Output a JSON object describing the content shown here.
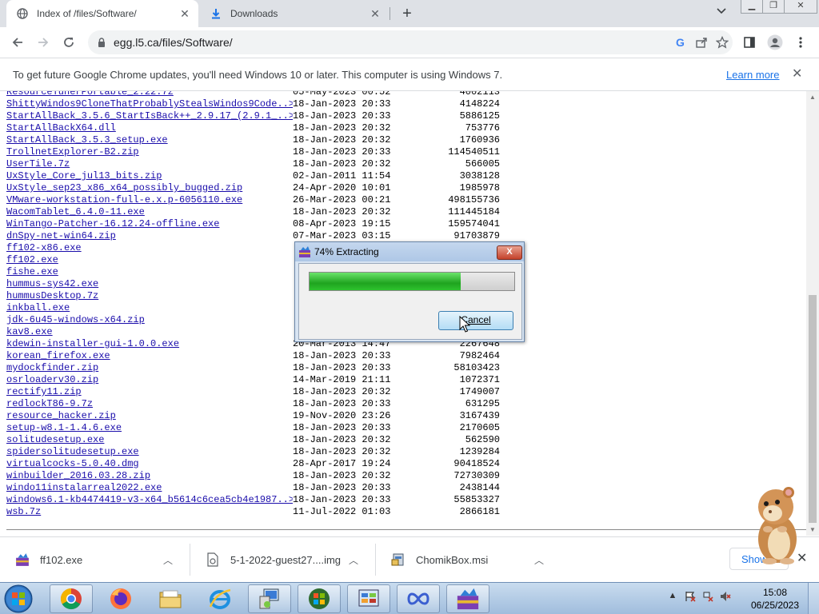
{
  "browser": {
    "tabs": [
      {
        "title": "Index of /files/Software/",
        "active": true
      },
      {
        "title": "Downloads",
        "active": false
      }
    ],
    "new_tab_label": "+",
    "url": "egg.l5.ca/files/Software/"
  },
  "infobar": {
    "message": "To get future Google Chrome updates, you'll need Windows 10 or later. This computer is using Windows 7.",
    "link": "Learn more"
  },
  "listing": [
    {
      "name": "ResourceTunerPortable_2.22.7z",
      "date": "05-May-2023 00:52",
      "size": "4002113"
    },
    {
      "name": "ShittyWindos9CloneThatProbablyStealsWindos9Code..>",
      "date": "18-Jan-2023 20:33",
      "size": "4148224"
    },
    {
      "name": "StartAllBack_3.5.6_StartIsBack++_2.9.17_(2.9.1_..>",
      "date": "18-Jan-2023 20:33",
      "size": "5886125"
    },
    {
      "name": "StartAllBackX64.dll",
      "date": "18-Jan-2023 20:32",
      "size": "753776"
    },
    {
      "name": "StartAllBack_3.5.3_setup.exe",
      "date": "18-Jan-2023 20:32",
      "size": "1760936"
    },
    {
      "name": "TrollnetExplorer-B2.zip",
      "date": "18-Jan-2023 20:33",
      "size": "114540511"
    },
    {
      "name": "UserTile.7z",
      "date": "18-Jan-2023 20:32",
      "size": "566005"
    },
    {
      "name": "UxStyle_Core_jul13_bits.zip",
      "date": "02-Jan-2011 11:54",
      "size": "3038128"
    },
    {
      "name": "UxStyle_sep23_x86_x64_possibly_bugged.zip",
      "date": "24-Apr-2020 10:01",
      "size": "1985978"
    },
    {
      "name": "VMware-workstation-full-e.x.p-6056110.exe",
      "date": "26-Mar-2023 00:21",
      "size": "498155736"
    },
    {
      "name": "WacomTablet_6.4.0-11.exe",
      "date": "18-Jan-2023 20:32",
      "size": "111445184"
    },
    {
      "name": "WinTango-Patcher-16.12.24-offline.exe",
      "date": "08-Apr-2023 19:15",
      "size": "159574041"
    },
    {
      "name": "dnSpy-net-win64.zip",
      "date": "07-Mar-2023 03:15",
      "size": "91703879"
    },
    {
      "name": "ff102-x86.exe",
      "date": "",
      "size": ""
    },
    {
      "name": "ff102.exe",
      "date": "",
      "size": ""
    },
    {
      "name": "fishe.exe",
      "date": "",
      "size": ""
    },
    {
      "name": "hummus-sys42.exe",
      "date": "",
      "size": ""
    },
    {
      "name": "hummusDesktop.7z",
      "date": "",
      "size": ""
    },
    {
      "name": "inkball.exe",
      "date": "",
      "size": ""
    },
    {
      "name": "jdk-6u45-windows-x64.zip",
      "date": "",
      "size": ""
    },
    {
      "name": "kav8.exe",
      "date": "",
      "size": ""
    },
    {
      "name": "kdewin-installer-gui-1.0.0.exe",
      "date": "20-Mar-2013 14:47",
      "size": "2267648"
    },
    {
      "name": "korean_firefox.exe",
      "date": "18-Jan-2023 20:33",
      "size": "7982464"
    },
    {
      "name": "mydockfinder.zip",
      "date": "18-Jan-2023 20:33",
      "size": "58103423"
    },
    {
      "name": "osrloaderv30.zip",
      "date": "14-Mar-2019 21:11",
      "size": "1072371"
    },
    {
      "name": "rectify11.zip",
      "date": "18-Jan-2023 20:32",
      "size": "1749007"
    },
    {
      "name": "redlockT86-9.7z",
      "date": "18-Jan-2023 20:33",
      "size": "631295"
    },
    {
      "name": "resource_hacker.zip",
      "date": "19-Nov-2020 23:26",
      "size": "3167439"
    },
    {
      "name": "setup-w8.1-1.4.6.exe",
      "date": "18-Jan-2023 20:33",
      "size": "2170605"
    },
    {
      "name": "solitudesetup.exe",
      "date": "18-Jan-2023 20:32",
      "size": "562590"
    },
    {
      "name": "spidersolitudesetup.exe",
      "date": "18-Jan-2023 20:32",
      "size": "1239284"
    },
    {
      "name": "virtualcocks-5.0.40.dmg",
      "date": "28-Apr-2017 19:24",
      "size": "90418524"
    },
    {
      "name": "winbuilder_2016.03.28.zip",
      "date": "18-Jan-2023 20:32",
      "size": "72730309"
    },
    {
      "name": "windo11instalarreal2022.exe",
      "date": "18-Jan-2023 20:33",
      "size": "2438144"
    },
    {
      "name": "windows6.1-kb4474419-v3-x64_b5614c6cea5cb4e1987..>",
      "date": "18-Jan-2023 20:33",
      "size": "55853327"
    },
    {
      "name": "wsb.7z",
      "date": "11-Jul-2022 01:03",
      "size": "2866181"
    }
  ],
  "dialog": {
    "title": "74% Extracting",
    "progress": 0.74,
    "cancel_label": "Cancel",
    "close_label": "X"
  },
  "downloads": {
    "items": [
      {
        "name": "ff102.exe",
        "icon": "installer-icon"
      },
      {
        "name": "5-1-2022-guest27....img",
        "icon": "disk-image-icon"
      },
      {
        "name": "ChomikBox.msi",
        "icon": "msi-package-icon"
      }
    ],
    "show_all_label": "Show all"
  },
  "taskbar": {
    "apps": [
      "chrome",
      "firefox",
      "file-explorer",
      "internet-explorer",
      "computer-management",
      "windows-logo-app",
      "control-panel",
      "infinity-app",
      "winrar-archive"
    ],
    "clock_time": "15:08",
    "clock_date": "06/25/2023"
  },
  "colors": {
    "link": "#1a0dab",
    "accent": "#1a73e8",
    "progress_fill": "#1fa41f"
  }
}
